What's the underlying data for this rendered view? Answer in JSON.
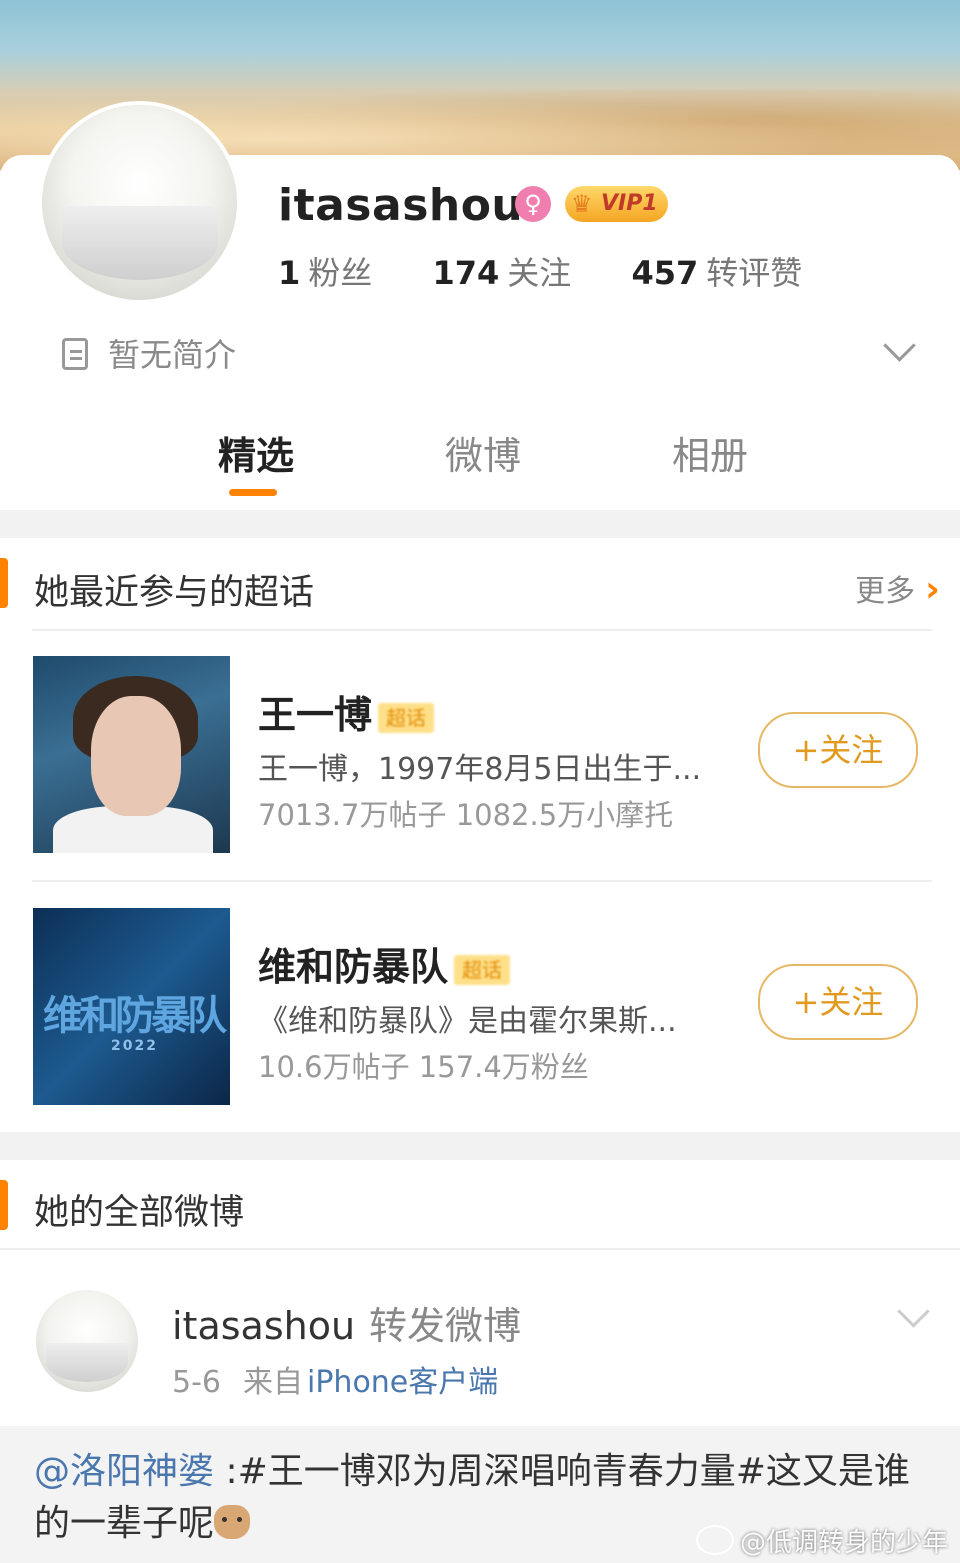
{
  "profile": {
    "username": "itasashou",
    "gender_icon": "♀",
    "vip_label": "VIP1",
    "stats": [
      {
        "num": "1",
        "label": "粉丝"
      },
      {
        "num": "174",
        "label": "关注"
      },
      {
        "num": "457",
        "label": "转评赞"
      }
    ],
    "bio": "暂无简介"
  },
  "tabs": [
    {
      "label": "精选",
      "active": true
    },
    {
      "label": "微博",
      "active": false
    },
    {
      "label": "相册",
      "active": false
    }
  ],
  "topics_section": {
    "title": "她最近参与的超话",
    "more_label": "更多",
    "items": [
      {
        "name": "王一博",
        "tag": "超话",
        "desc": "王一博，1997年8月5日出生于...",
        "meta": "7013.7万帖子 1082.5万小摩托",
        "follow_label": "+关注"
      },
      {
        "name": "维和防暴队",
        "tag": "超话",
        "desc": "《维和防暴队》是由霍尔果斯...",
        "meta": "10.6万帖子 157.4万粉丝",
        "follow_label": "+关注",
        "poster_title": "维和防暴队",
        "poster_year": "2022"
      }
    ]
  },
  "posts_section": {
    "title": "她的全部微博",
    "post": {
      "user": "itasashou",
      "action": "转发微博",
      "date": "5-6",
      "source_prefix": "来自",
      "source": "iPhone客户端",
      "repost_mention": "@洛阳神婆",
      "repost_text": " :#王一博邓为周深唱响青春力量#这又是谁的一辈子呢"
    }
  },
  "watermark": "@低调转身的少年",
  "colors": {
    "accent": "#ff8200",
    "follow": "#e19a1f",
    "link": "#4a77ad"
  }
}
